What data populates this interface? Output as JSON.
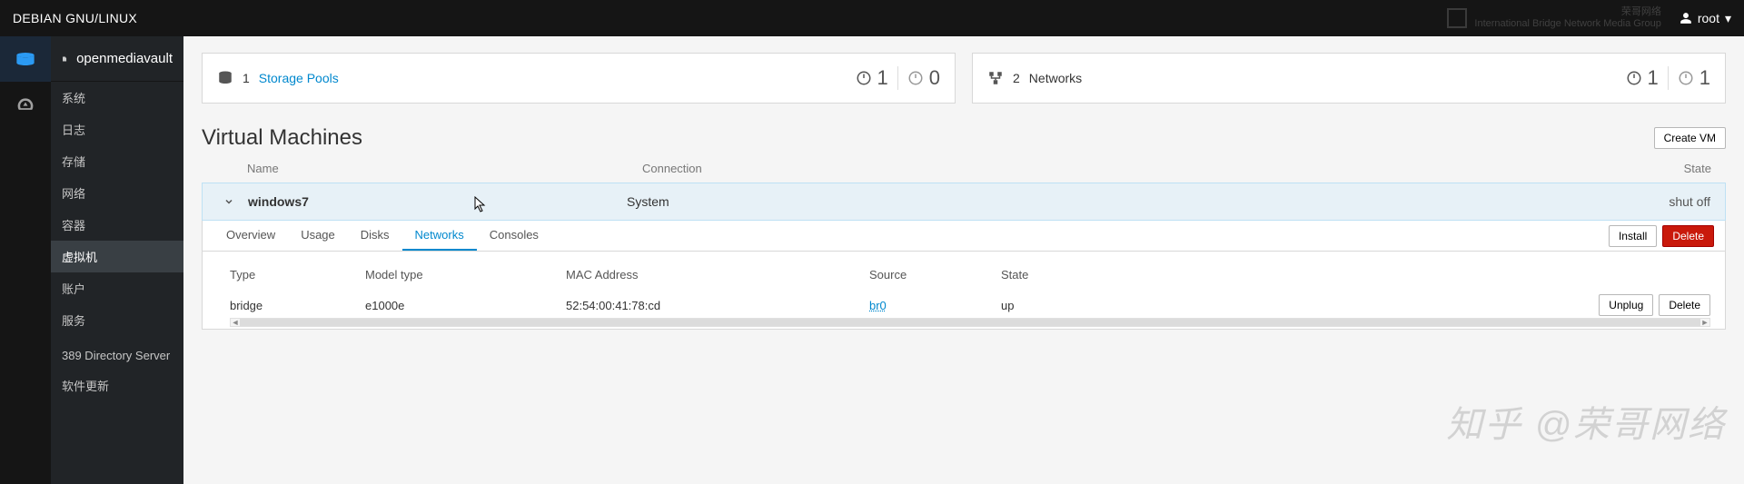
{
  "topbar": {
    "title": "DEBIAN GNU/LINUX",
    "watermark_line1": "荣哥网络",
    "watermark_line2": "International Bridge Network Media Group",
    "user": "root",
    "caret": "▾"
  },
  "nav": {
    "header": "openmediavault",
    "items": [
      "系统",
      "日志",
      "存储",
      "网络",
      "容器",
      "虚拟机",
      "账户",
      "服务",
      "389 Directory Server",
      "软件更新"
    ],
    "active_index": 5
  },
  "cards": {
    "storage": {
      "count": "1",
      "label": "Storage Pools",
      "running": "1",
      "stopped": "0"
    },
    "networks": {
      "count": "2",
      "label": "Networks",
      "running": "1",
      "stopped": "1"
    }
  },
  "section": {
    "title": "Virtual Machines",
    "create_btn": "Create VM",
    "cols": {
      "name": "Name",
      "connection": "Connection",
      "state": "State"
    }
  },
  "vm": {
    "name": "windows7",
    "connection": "System",
    "state": "shut off",
    "tabs": [
      "Overview",
      "Usage",
      "Disks",
      "Networks",
      "Consoles"
    ],
    "active_tab": 3,
    "actions": {
      "install": "Install",
      "delete": "Delete"
    }
  },
  "net": {
    "head": {
      "type": "Type",
      "model": "Model type",
      "mac": "MAC Address",
      "source": "Source",
      "state": "State"
    },
    "rows": [
      {
        "type": "bridge",
        "model": "e1000e",
        "mac": "52:54:00:41:78:cd",
        "source": "br0",
        "state": "up",
        "act1": "Unplug",
        "act2": "Delete"
      }
    ]
  },
  "watermark": "知乎 @荣哥网络"
}
